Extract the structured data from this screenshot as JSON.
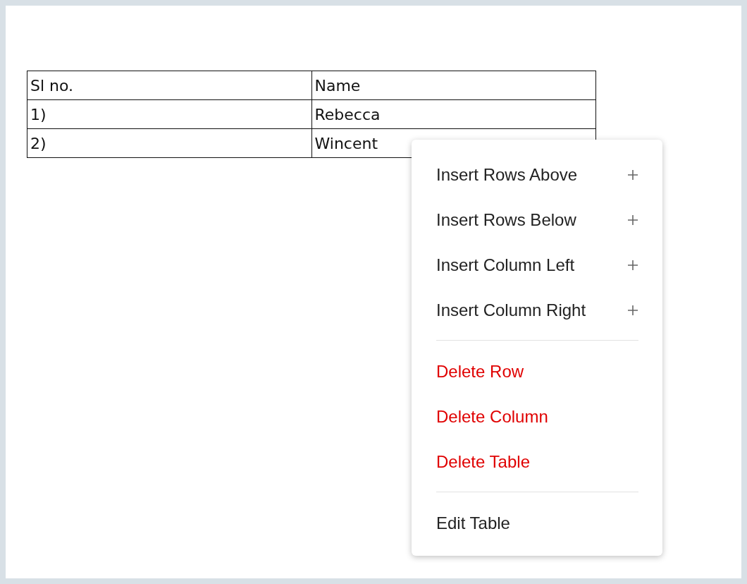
{
  "table": {
    "columns": [
      "Sl no.",
      "Name"
    ],
    "rows": [
      [
        "1)",
        "Rebecca"
      ],
      [
        "2)",
        "Wincent"
      ]
    ]
  },
  "context_menu": {
    "groups": [
      {
        "items": [
          {
            "label": "Insert Rows Above",
            "kind": "insert"
          },
          {
            "label": "Insert Rows Below",
            "kind": "insert"
          },
          {
            "label": "Insert Column Left",
            "kind": "insert"
          },
          {
            "label": "Insert Column Right",
            "kind": "insert"
          }
        ]
      },
      {
        "items": [
          {
            "label": "Delete Row",
            "kind": "delete"
          },
          {
            "label": "Delete Column",
            "kind": "delete"
          },
          {
            "label": "Delete Table",
            "kind": "delete"
          }
        ]
      },
      {
        "items": [
          {
            "label": "Edit Table",
            "kind": "edit"
          }
        ]
      }
    ]
  }
}
